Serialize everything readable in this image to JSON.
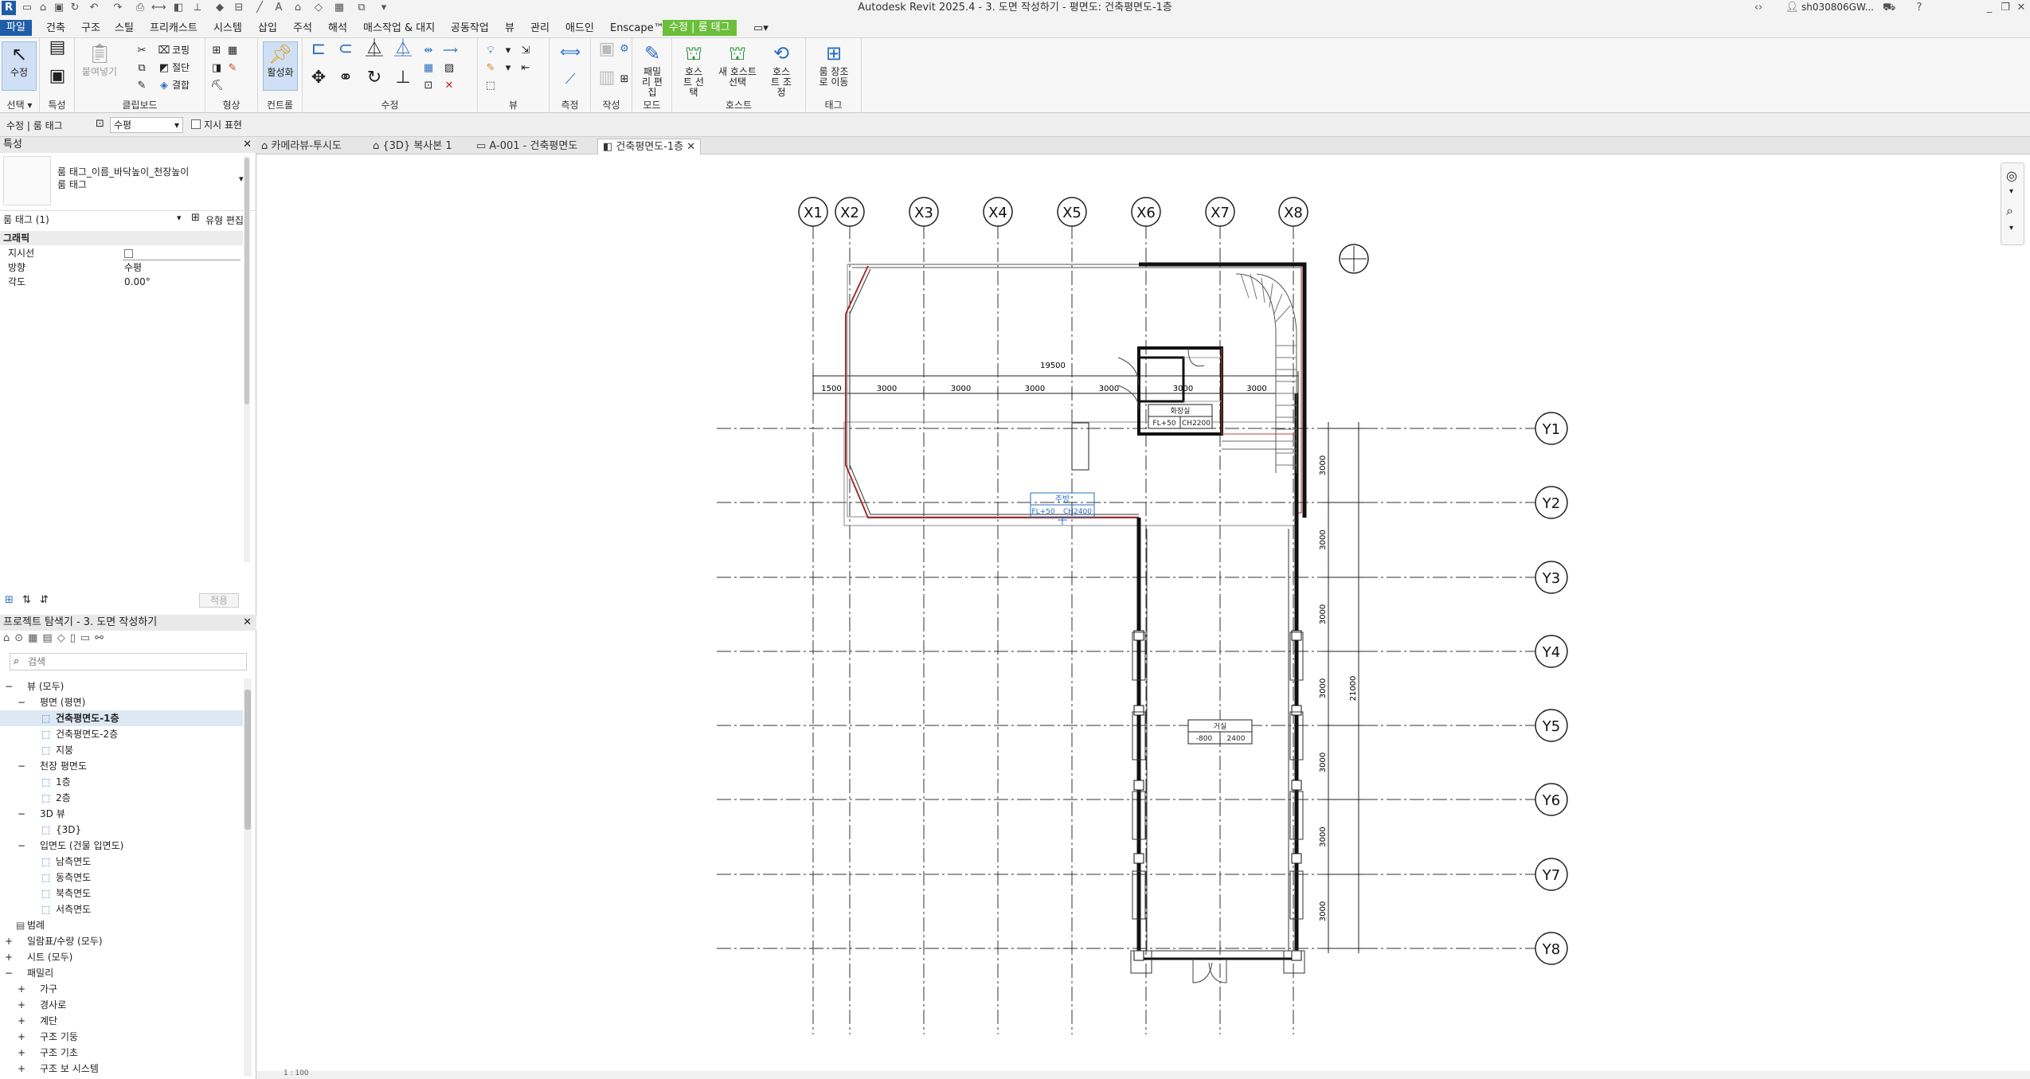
{
  "window": {
    "title": "Autodesk Revit 2025.4 - 3. 도면 작성하기 - 평면도: 건축평면도-1층",
    "user": "sh030806GW...",
    "app_icon": "R"
  },
  "ribbon_tabs": [
    {
      "label": "파일",
      "active": true
    },
    {
      "label": "건축"
    },
    {
      "label": "구조"
    },
    {
      "label": "스틸"
    },
    {
      "label": "프리캐스트"
    },
    {
      "label": "시스템"
    },
    {
      "label": "삽입"
    },
    {
      "label": "주석"
    },
    {
      "label": "해석"
    },
    {
      "label": "매스작업 & 대지"
    },
    {
      "label": "공동작업"
    },
    {
      "label": "뷰"
    },
    {
      "label": "관리"
    },
    {
      "label": "애드인"
    },
    {
      "label": "Enscape™"
    },
    {
      "label": "수정 | 룸 태그",
      "contextual": true
    }
  ],
  "ribbon": {
    "modify_label": "수정",
    "groups": [
      "선택 ▾",
      "특성",
      "클립보드",
      "형상",
      "컨트롤",
      "수정",
      "뷰",
      "측정",
      "작성",
      "모드",
      "호스트",
      "태그"
    ],
    "buttons": {
      "paste": "붙여넣기",
      "cope": "코핑",
      "cut": "절단",
      "join": "결합",
      "activate": "활성화",
      "edit_family": "패밀리 편집",
      "pick_host": "호스트 선택",
      "new_host": "새 호스트 선택",
      "host_adjust": "호스트 조정",
      "move_room": "룸 장조로 이동"
    }
  },
  "options_bar": {
    "context": "수정 | 룸 태그",
    "orientation": "수평",
    "leader_label": "지시 표현"
  },
  "properties": {
    "header": "특성",
    "type_name": "룸 태그_이름_바닥높이_천장높이",
    "type_sub": "룸 태그",
    "selector": "룸 태그 (1)",
    "edit_type": "유형 편집",
    "section": "그래픽",
    "rows": [
      {
        "name": "지시선",
        "value": ""
      },
      {
        "name": "방향",
        "value": "수평"
      },
      {
        "name": "각도",
        "value": "0.00°"
      }
    ],
    "apply": "적용"
  },
  "browser": {
    "header": "프로젝트 탐색기 - 3. 도면 작성하기",
    "search_placeholder": "검색",
    "items": [
      {
        "label": "뷰 (모두)",
        "indent": 0,
        "toggle": "−"
      },
      {
        "label": "평면 (평면)",
        "indent": 1,
        "toggle": "−"
      },
      {
        "label": "건축평면도-1층",
        "indent": 2,
        "selected": true
      },
      {
        "label": "건축평면도-2층",
        "indent": 2
      },
      {
        "label": "지붕",
        "indent": 2
      },
      {
        "label": "천장 평면도",
        "indent": 1,
        "toggle": "−"
      },
      {
        "label": "1층",
        "indent": 2
      },
      {
        "label": "2층",
        "indent": 2
      },
      {
        "label": "3D 뷰",
        "indent": 1,
        "toggle": "−"
      },
      {
        "label": "{3D}",
        "indent": 2
      },
      {
        "label": "입면도 (건물 입면도)",
        "indent": 1,
        "toggle": "−"
      },
      {
        "label": "남측면도",
        "indent": 2
      },
      {
        "label": "동측면도",
        "indent": 2
      },
      {
        "label": "북측면도",
        "indent": 2
      },
      {
        "label": "서측면도",
        "indent": 2
      },
      {
        "label": "범례",
        "indent": 0
      },
      {
        "label": "일람표/수량 (모두)",
        "indent": 0,
        "toggle": "+"
      },
      {
        "label": "시트 (모두)",
        "indent": 0,
        "toggle": "+"
      },
      {
        "label": "패밀리",
        "indent": 0,
        "toggle": "−"
      },
      {
        "label": "가구",
        "indent": 1,
        "toggle": "+"
      },
      {
        "label": "경사로",
        "indent": 1,
        "toggle": "+"
      },
      {
        "label": "계단",
        "indent": 1,
        "toggle": "+"
      },
      {
        "label": "구조 기둥",
        "indent": 1,
        "toggle": "+"
      },
      {
        "label": "구조 기초",
        "indent": 1,
        "toggle": "+"
      },
      {
        "label": "구조 보 시스템",
        "indent": 1,
        "toggle": "+"
      }
    ]
  },
  "view_tabs": [
    {
      "label": "카메라뷰-투시도"
    },
    {
      "label": "{3D} 복사본 1"
    },
    {
      "label": "A-001 - 건축평면도"
    },
    {
      "label": "건축평면도-1층",
      "active": true
    }
  ],
  "drawing": {
    "x_grids": [
      "X1",
      "X2",
      "X3",
      "X4",
      "X5",
      "X6",
      "X7",
      "X8"
    ],
    "y_grids": [
      "Y1",
      "Y2",
      "Y3",
      "Y4",
      "Y5",
      "Y6",
      "Y7",
      "Y8"
    ],
    "overall_dim": "19500",
    "x_dims": [
      "1500",
      "3000",
      "3000",
      "3000",
      "3000",
      "3000",
      "3000"
    ],
    "y_dims": [
      "3000",
      "3000",
      "3000",
      "3000",
      "3000",
      "3000",
      "3000"
    ],
    "total_y_dim": "21000",
    "room_tags": [
      {
        "name": "주방",
        "floor": "FL+50",
        "ceiling": "CH2400"
      },
      {
        "name": "화장실",
        "floor": "FL+50",
        "ceiling": "CH2200"
      },
      {
        "name": "거실",
        "floor": "-800",
        "ceiling": "2400"
      }
    ]
  },
  "status": {
    "scale": "1 : 100"
  }
}
